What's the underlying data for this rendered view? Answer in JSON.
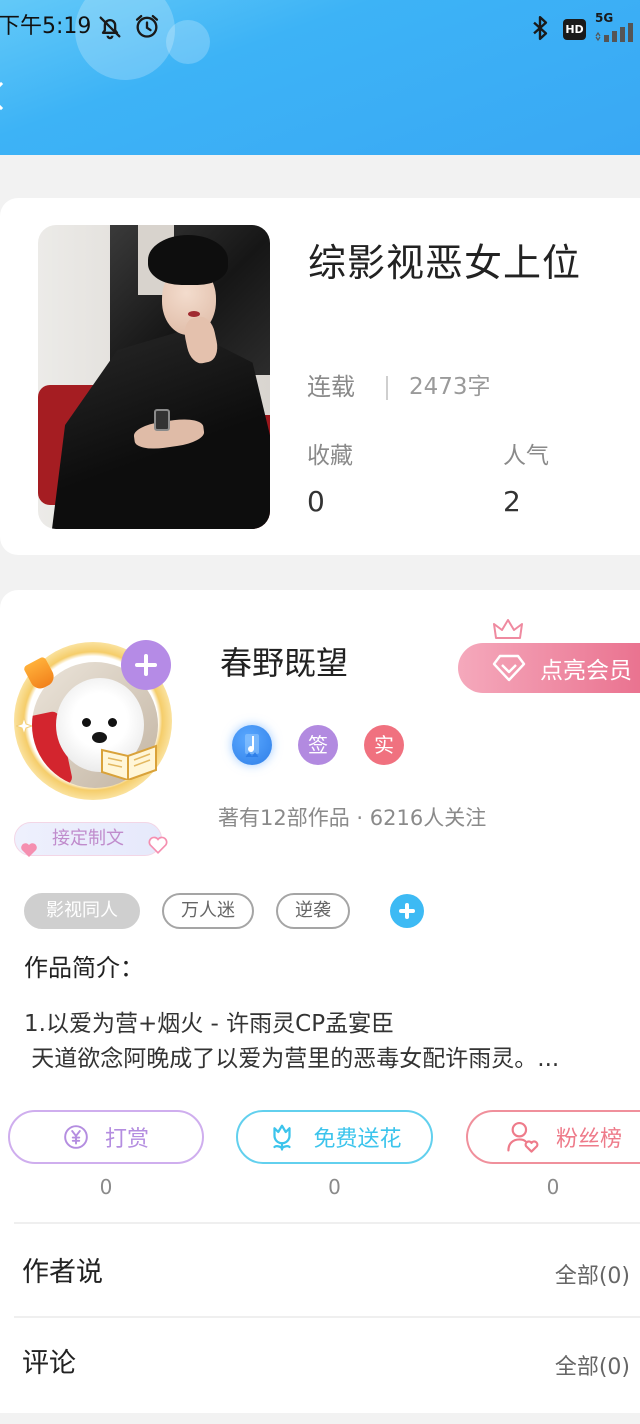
{
  "status_bar": {
    "time": "下午5:19",
    "hd_label": "HD",
    "network_label": "5G",
    "icons": [
      "bell-off-icon",
      "alarm-icon",
      "bluetooth-icon",
      "signal-icon"
    ]
  },
  "header": {
    "back_icon": "chevron-left-icon",
    "background": "#3aaef5"
  },
  "book": {
    "title": "综影视恶女上位",
    "status": "连载",
    "word_count": "2473字",
    "favorites": {
      "label": "收藏",
      "value": "0"
    },
    "popularity": {
      "label": "人气",
      "value": "2"
    }
  },
  "author": {
    "name": "春野既望",
    "custom_badge": "接定制文",
    "vip_button": "点亮会员",
    "badges": [
      {
        "icon": "music-note-icon",
        "color": "#3a8ef0"
      },
      {
        "text": "签",
        "color": "#b28ae0"
      },
      {
        "text": "实",
        "color": "#f0717f"
      }
    ],
    "stats": "著有12部作品 · 6216人关注"
  },
  "tags": [
    {
      "label": "影视同人",
      "selected": true
    },
    {
      "label": "万人迷",
      "selected": false
    },
    {
      "label": "逆袭",
      "selected": false
    }
  ],
  "synopsis": {
    "label": "作品简介：",
    "lines": [
      "1.以爱为营+烟火 - 许雨灵CP孟宴臣",
      " 天道欲念阿晚成了以爱为营里的恶毒女配许雨灵。..."
    ]
  },
  "actions": [
    {
      "label": "打赏",
      "count": "0",
      "icon": "yuan-icon",
      "color": "#b48de0"
    },
    {
      "label": "免费送花",
      "count": "0",
      "icon": "flower-icon",
      "color": "#3cc4ec"
    },
    {
      "label": "粉丝榜",
      "count": "0",
      "icon": "fan-list-icon",
      "color": "#ee7b8a"
    }
  ],
  "sections": [
    {
      "title": "作者说",
      "link": "全部(0)"
    },
    {
      "title": "评论",
      "link": "全部(0)"
    }
  ],
  "colors": {
    "accent_blue": "#3aaef5",
    "page_background": "#f2f2f2",
    "vip_pink": "#ec7892"
  }
}
